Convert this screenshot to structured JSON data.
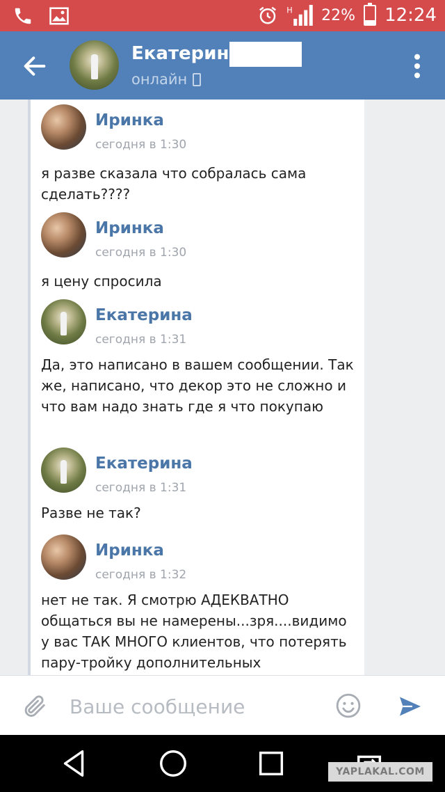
{
  "status_bar": {
    "battery_percent": "22%",
    "time": "12:24",
    "network": "H",
    "battery_level": 0.22
  },
  "header": {
    "contact_name": "Екатерина",
    "status": "онлайн",
    "back_icon": "arrow-left-icon",
    "menu_icon": "more-vertical-icon"
  },
  "messages": [
    {
      "sender": "Иринка",
      "time": "сегодня в 1:30",
      "text": "я разве сказала что собралась сама сделать????",
      "avatar": "irinka"
    },
    {
      "sender": "Иринка",
      "time": "сегодня в 1:30",
      "text": "я цену спросила",
      "avatar": "irinka"
    },
    {
      "sender": "Екатерина",
      "time": "сегодня в 1:31",
      "text": "Да, это написано в вашем сообщении. Так же, написано, что декор это не сложно и что вам надо знать где я что покупаю",
      "avatar": "ekaterina"
    },
    {
      "sender": "Екатерина",
      "time": "сегодня в 1:31",
      "text": "Разве не так?",
      "avatar": "ekaterina"
    },
    {
      "sender": "Иринка",
      "time": "сегодня в 1:32",
      "text": "нет не так. Я смотрю АДЕКВАТНО общаться вы не намерены...зря....видимо у вас ТАК МНОГО клиентов, что потерять пару-тройку дополнительных",
      "avatar": "irinka"
    }
  ],
  "composer": {
    "placeholder": "Ваше сообщение",
    "value": ""
  },
  "watermark": "YAPLAKAL.COM",
  "colors": {
    "status_bar": "#d54b4c",
    "app_bar": "#5181b8",
    "sender_name": "#4a76a8",
    "send_icon": "#5181b8"
  }
}
